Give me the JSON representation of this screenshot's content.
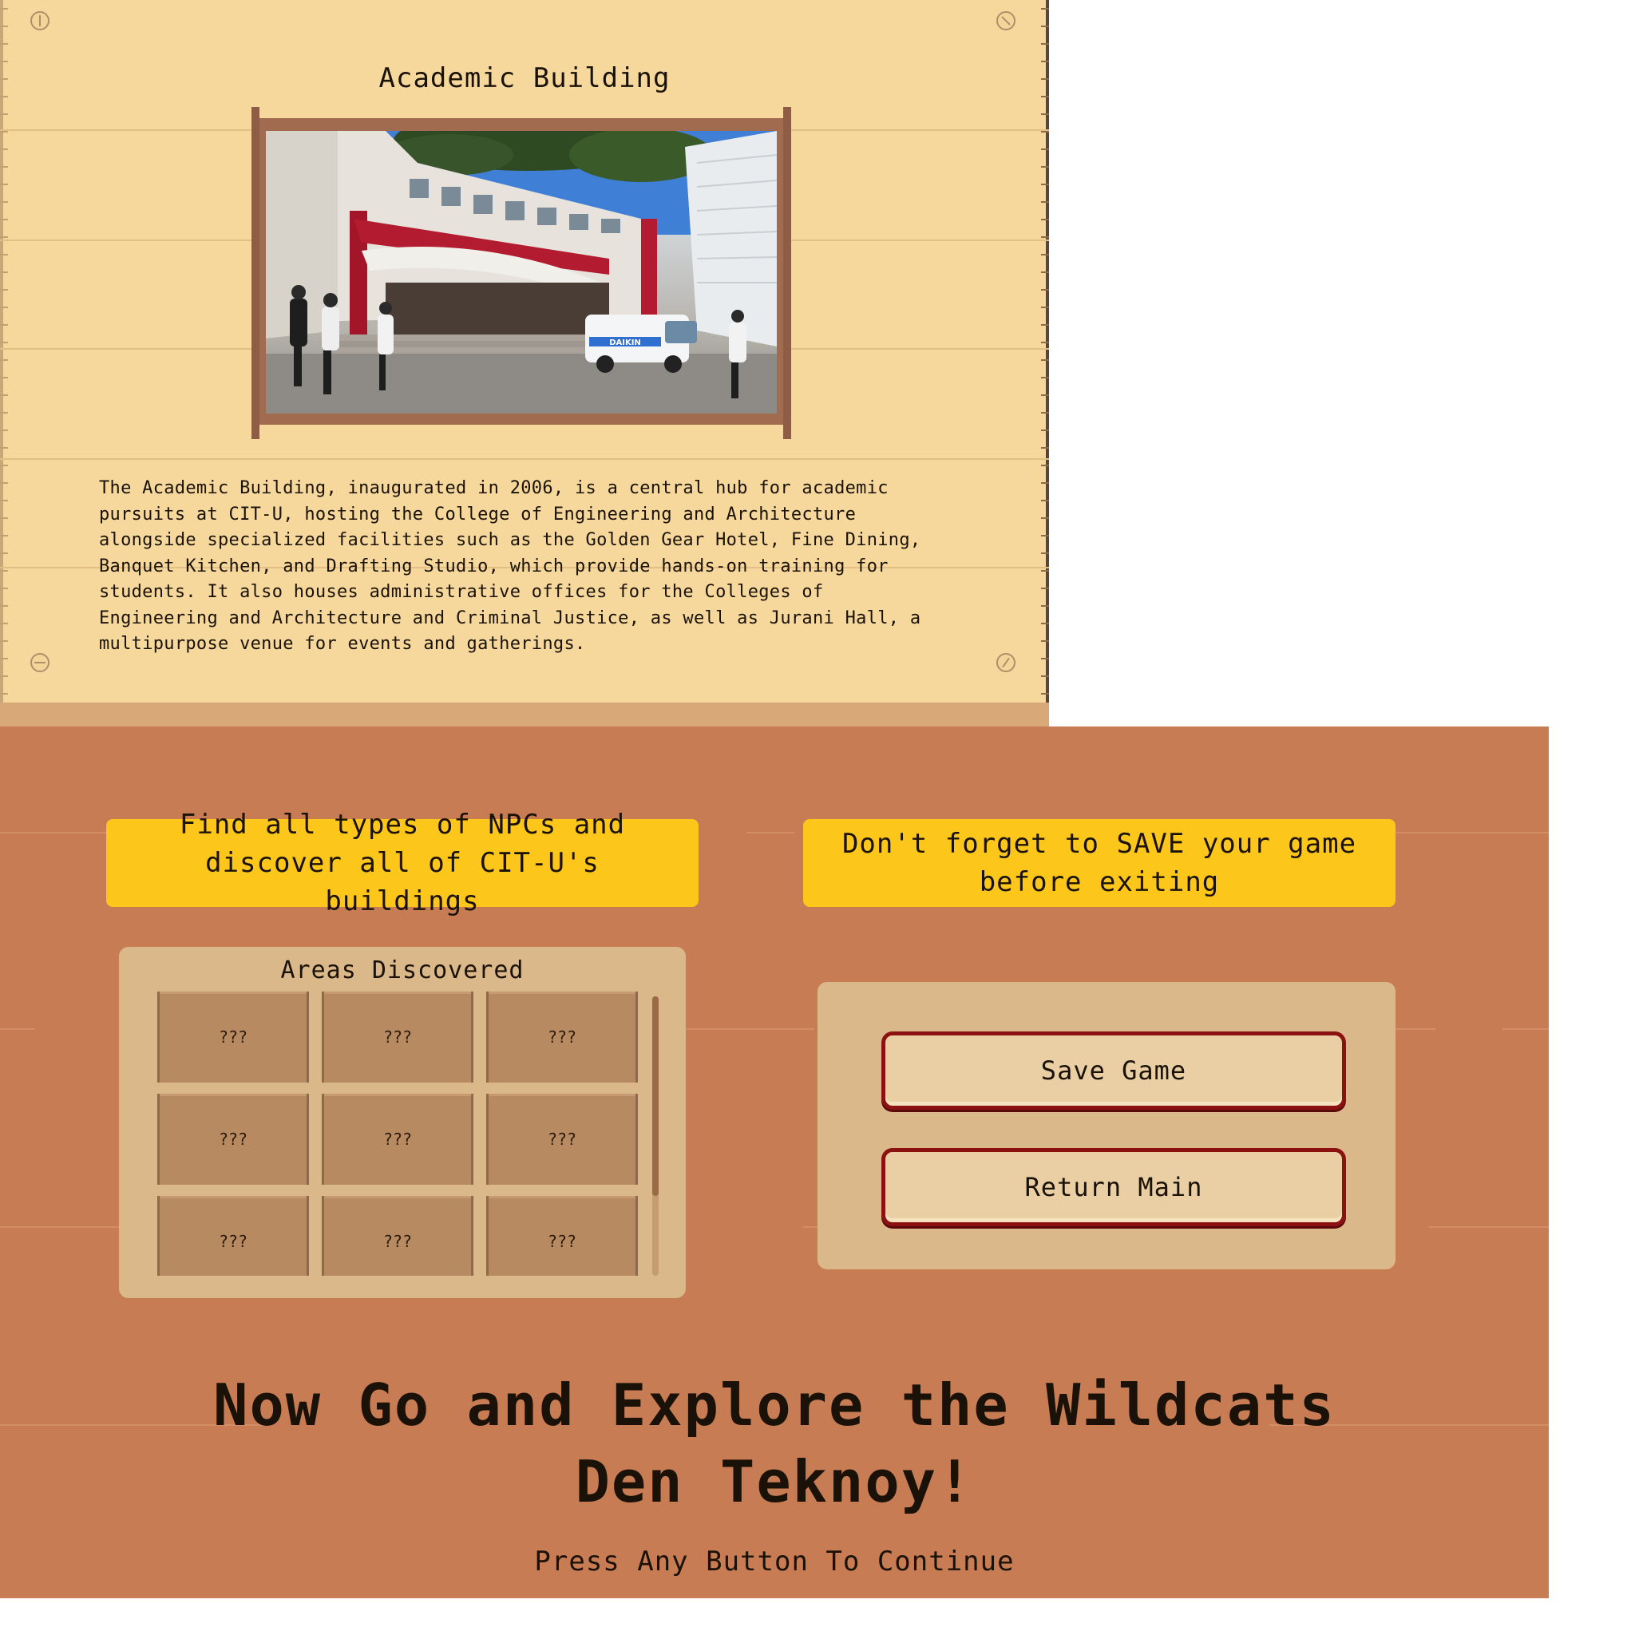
{
  "info_panel": {
    "title": "Academic Building",
    "description": "The Academic Building, inaugurated in 2006, is a central hub for academic pursuits at CIT-U, hosting the College of Engineering and Architecture alongside specialized facilities such as the Golden Gear Hotel, Fine Dining, Banquet Kitchen, and Drafting Studio, which provide hands-on training for students. It also houses administrative offices for the Colleges of Engineering and Architecture and Criminal Justice, as well as Jurani Hall, a multipurpose venue for events and gatherings.",
    "photo_sign_text": "DAIKIN"
  },
  "hints": {
    "left": "Find all types of NPCs and discover all of CIT-U's buildings",
    "right": "Don't forget to SAVE your game before exiting"
  },
  "areas": {
    "title": "Areas Discovered",
    "cells": [
      "???",
      "???",
      "???",
      "???",
      "???",
      "???",
      "???",
      "???",
      "???"
    ]
  },
  "menu": {
    "save_label": "Save Game",
    "return_label": "Return Main"
  },
  "outro": {
    "line1": "Now Go and Explore the Wildcats",
    "line2": "Den Teknoy!",
    "continue_text": "Press Any Button To Continue"
  },
  "colors": {
    "parchment": "#f6d89c",
    "panel": "#c77c54",
    "hint_yellow": "#fcc61a",
    "box_tan": "#dbb88a",
    "button_border": "#8c1212"
  }
}
